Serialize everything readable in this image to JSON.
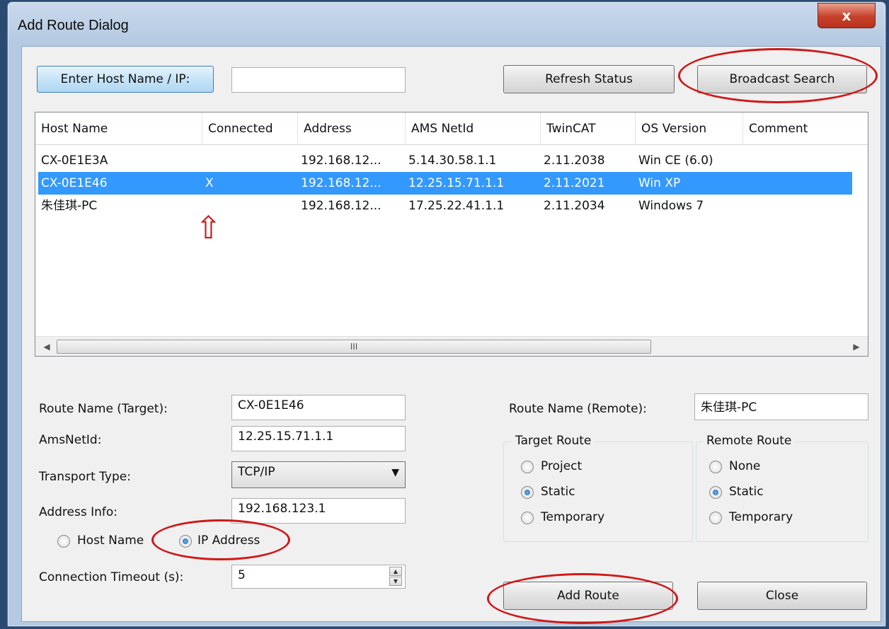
{
  "window": {
    "title": "Add Route Dialog",
    "close_glyph": "x"
  },
  "top": {
    "enter_host_label": "Enter Host Name / IP:",
    "host_input_value": "",
    "refresh_label": "Refresh Status",
    "broadcast_label": "Broadcast Search"
  },
  "list": {
    "columns": [
      "Host Name",
      "Connected",
      "Address",
      "AMS NetId",
      "TwinCAT",
      "OS Version",
      "Comment"
    ],
    "rows": [
      [
        "CX-0E1E3A",
        "",
        "192.168.12...",
        "5.14.30.58.1.1",
        "2.11.2038",
        "Win CE (6.0)",
        ""
      ],
      [
        "CX-0E1E46",
        "X",
        "192.168.12...",
        "12.25.15.71.1.1",
        "2.11.2021",
        "Win XP",
        ""
      ],
      [
        "朱佳琪-PC",
        "",
        "192.168.12...",
        "17.25.22.41.1.1",
        "2.11.2034",
        "Windows 7",
        ""
      ]
    ],
    "selected_row": 1,
    "scroll_grip": "III"
  },
  "form": {
    "route_name_target_label": "Route Name (Target):",
    "route_name_target_value": "CX-0E1E46",
    "amsnetid_label": "AmsNetId:",
    "amsnetid_value": "12.25.15.71.1.1",
    "transport_label": "Transport Type:",
    "transport_value": "TCP/IP",
    "address_info_label": "Address Info:",
    "address_info_value": "192.168.123.1",
    "host_name_radio": "Host Name",
    "ip_address_radio": "IP Address",
    "address_mode_selected": "IP Address",
    "timeout_label": "Connection Timeout (s):",
    "timeout_value": "5",
    "route_name_remote_label": "Route Name (Remote):",
    "route_name_remote_value": "朱佳琪-PC"
  },
  "target_route": {
    "title": "Target Route",
    "options": [
      "Project",
      "Static",
      "Temporary"
    ],
    "selected": "Static"
  },
  "remote_route": {
    "title": "Remote Route",
    "options": [
      "None",
      "Static",
      "Temporary"
    ],
    "selected": "Static"
  },
  "buttons": {
    "add_route": "Add Route",
    "close": "Close"
  },
  "annotations": {
    "arrow_glyph": "⇧",
    "color": "#d01818"
  }
}
